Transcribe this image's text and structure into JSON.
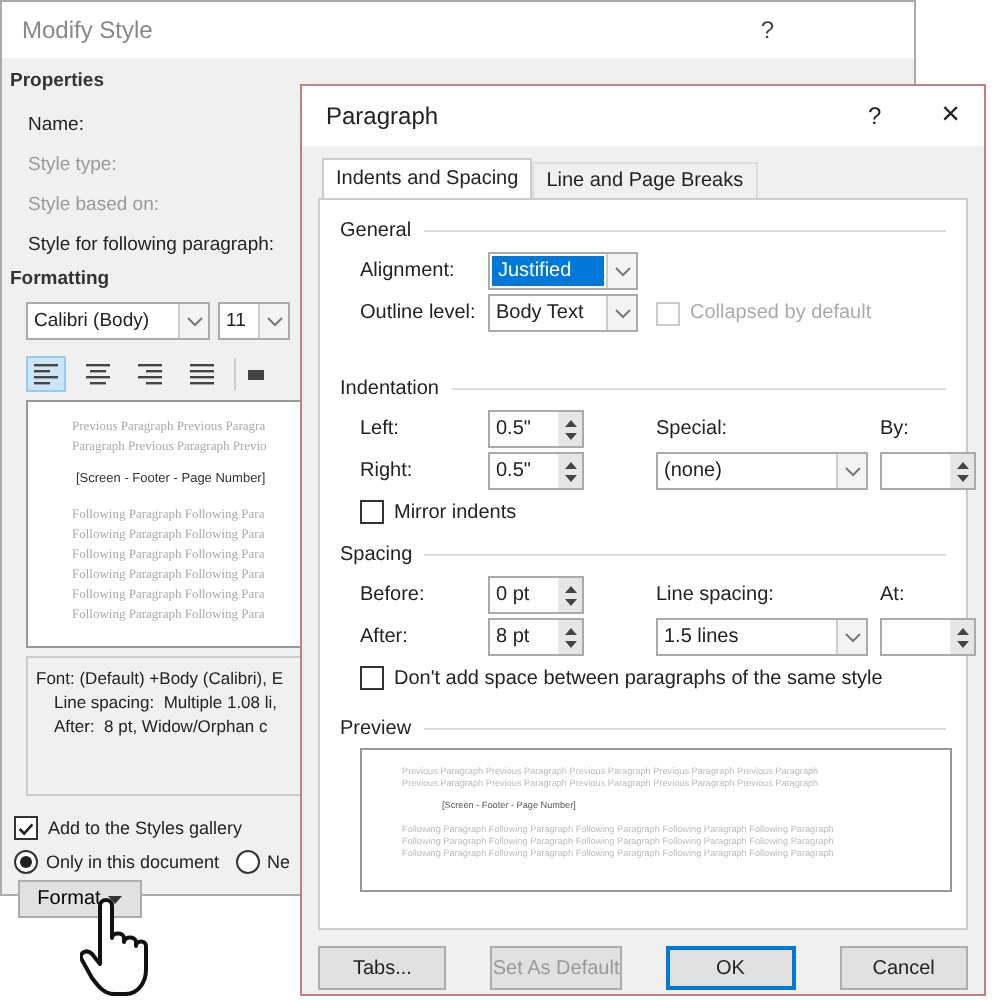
{
  "modify_style": {
    "title": "Modify Style",
    "help": "?",
    "properties_heading": "Properties",
    "properties": [
      {
        "label": "Name:",
        "disabled": false
      },
      {
        "label": "Style type:",
        "disabled": true
      },
      {
        "label": "Style based on:",
        "disabled": true
      },
      {
        "label": "Style for following paragraph:",
        "disabled": false
      }
    ],
    "formatting_heading": "Formatting",
    "font": "Calibri (Body)",
    "size": "11",
    "alignment": [
      {
        "kind": "left",
        "selected": true
      },
      {
        "kind": "center",
        "selected": false
      },
      {
        "kind": "right",
        "selected": false
      },
      {
        "kind": "justify",
        "selected": false
      }
    ],
    "preview": {
      "previous": [
        "Previous Paragraph Previous Paragra",
        "Paragraph Previous Paragraph Previo"
      ],
      "sample": "[Screen - Footer - Page Number]",
      "following": [
        "Following Paragraph Following Para",
        "Following Paragraph Following Para",
        "Following Paragraph Following Para",
        "Following Paragraph Following Para",
        "Following Paragraph Following Para",
        "Following Paragraph Following Para"
      ]
    },
    "description": [
      "Font: (Default) +Body (Calibri), E",
      "Line spacing:  Multiple 1.08 li,",
      "After:  8 pt, Widow/Orphan c"
    ],
    "add_to_gallery": {
      "label": "Add to the Styles gallery",
      "checked": true
    },
    "scope": [
      {
        "label": "Only in this document",
        "selected": true
      },
      {
        "label": "Ne",
        "selected": false
      }
    ],
    "format_button": "Format"
  },
  "paragraph": {
    "title": "Paragraph",
    "help": "?",
    "close": "×",
    "tabs": [
      {
        "label": "Indents and Spacing",
        "selected": true
      },
      {
        "label": "Line and Page Breaks",
        "selected": false
      }
    ],
    "general": {
      "heading": "General",
      "alignment_label": "Alignment:",
      "alignment": "Justified",
      "alignment_selected": true,
      "outline_label": "Outline level:",
      "outline": "Body Text",
      "collapsed": {
        "label": "Collapsed by default",
        "checked": false,
        "disabled": true
      }
    },
    "indentation": {
      "heading": "Indentation",
      "left_label": "Left:",
      "left": "0.5\"",
      "right_label": "Right:",
      "right": "0.5\"",
      "special_label": "Special:",
      "special": "(none)",
      "by_label": "By:",
      "mirror": {
        "label": "Mirror indents",
        "checked": false,
        "disabled": false
      }
    },
    "spacing": {
      "heading": "Spacing",
      "before_label": "Before:",
      "before": "0 pt",
      "after_label": "After:",
      "after": "8 pt",
      "line_spacing_label": "Line spacing:",
      "line_spacing": "1.5 lines",
      "at_label": "At:",
      "dont_add": {
        "label": "Don't add space between paragraphs of the same style",
        "checked": false,
        "disabled": false
      }
    },
    "preview": {
      "heading": "Preview",
      "previous": [
        "Previous Paragraph Previous Paragraph Previous Paragraph Previous Paragraph Previous Paragraph",
        "Previous Paragraph Previous Paragraph Previous Paragraph Previous Paragraph Previous Paragraph"
      ],
      "sample": "[Screen - Footer - Page Number]",
      "following": [
        "Following Paragraph Following Paragraph Following Paragraph Following Paragraph Following Paragraph",
        "Following Paragraph Following Paragraph Following Paragraph Following Paragraph Following Paragraph",
        "Following Paragraph Following Paragraph Following Paragraph Following Paragraph Following Paragraph"
      ]
    },
    "buttons": [
      {
        "label": "Tabs...",
        "kind": "normal"
      },
      {
        "label": "Set As Default",
        "kind": "disabled"
      },
      {
        "label": "OK",
        "kind": "default"
      },
      {
        "label": "Cancel",
        "kind": "normal"
      }
    ]
  }
}
